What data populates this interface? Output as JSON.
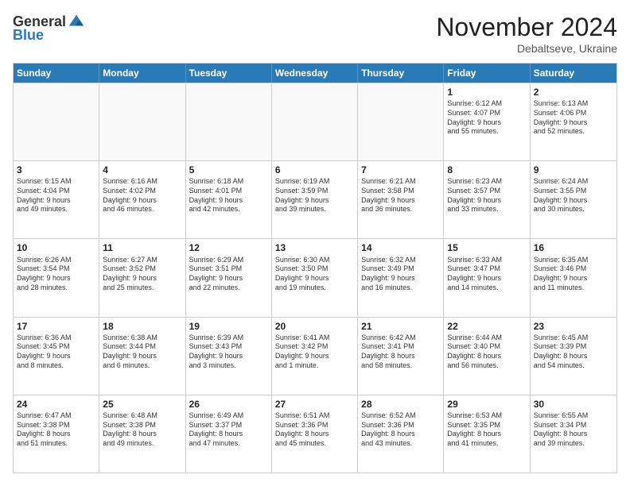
{
  "logo": {
    "general": "General",
    "blue": "Blue"
  },
  "title": "November 2024",
  "location": "Debaltseve, Ukraine",
  "header_days": [
    "Sunday",
    "Monday",
    "Tuesday",
    "Wednesday",
    "Thursday",
    "Friday",
    "Saturday"
  ],
  "rows": [
    [
      {
        "day": "",
        "text": "",
        "empty": true
      },
      {
        "day": "",
        "text": "",
        "empty": true
      },
      {
        "day": "",
        "text": "",
        "empty": true
      },
      {
        "day": "",
        "text": "",
        "empty": true
      },
      {
        "day": "",
        "text": "",
        "empty": true
      },
      {
        "day": "1",
        "text": "Sunrise: 6:12 AM\nSunset: 4:07 PM\nDaylight: 9 hours\nand 55 minutes.",
        "empty": false
      },
      {
        "day": "2",
        "text": "Sunrise: 6:13 AM\nSunset: 4:06 PM\nDaylight: 9 hours\nand 52 minutes.",
        "empty": false
      }
    ],
    [
      {
        "day": "3",
        "text": "Sunrise: 6:15 AM\nSunset: 4:04 PM\nDaylight: 9 hours\nand 49 minutes.",
        "empty": false
      },
      {
        "day": "4",
        "text": "Sunrise: 6:16 AM\nSunset: 4:02 PM\nDaylight: 9 hours\nand 46 minutes.",
        "empty": false
      },
      {
        "day": "5",
        "text": "Sunrise: 6:18 AM\nSunset: 4:01 PM\nDaylight: 9 hours\nand 42 minutes.",
        "empty": false
      },
      {
        "day": "6",
        "text": "Sunrise: 6:19 AM\nSunset: 3:59 PM\nDaylight: 9 hours\nand 39 minutes.",
        "empty": false
      },
      {
        "day": "7",
        "text": "Sunrise: 6:21 AM\nSunset: 3:58 PM\nDaylight: 9 hours\nand 36 minutes.",
        "empty": false
      },
      {
        "day": "8",
        "text": "Sunrise: 6:23 AM\nSunset: 3:57 PM\nDaylight: 9 hours\nand 33 minutes.",
        "empty": false
      },
      {
        "day": "9",
        "text": "Sunrise: 6:24 AM\nSunset: 3:55 PM\nDaylight: 9 hours\nand 30 minutes.",
        "empty": false
      }
    ],
    [
      {
        "day": "10",
        "text": "Sunrise: 6:26 AM\nSunset: 3:54 PM\nDaylight: 9 hours\nand 28 minutes.",
        "empty": false
      },
      {
        "day": "11",
        "text": "Sunrise: 6:27 AM\nSunset: 3:52 PM\nDaylight: 9 hours\nand 25 minutes.",
        "empty": false
      },
      {
        "day": "12",
        "text": "Sunrise: 6:29 AM\nSunset: 3:51 PM\nDaylight: 9 hours\nand 22 minutes.",
        "empty": false
      },
      {
        "day": "13",
        "text": "Sunrise: 6:30 AM\nSunset: 3:50 PM\nDaylight: 9 hours\nand 19 minutes.",
        "empty": false
      },
      {
        "day": "14",
        "text": "Sunrise: 6:32 AM\nSunset: 3:49 PM\nDaylight: 9 hours\nand 16 minutes.",
        "empty": false
      },
      {
        "day": "15",
        "text": "Sunrise: 6:33 AM\nSunset: 3:47 PM\nDaylight: 9 hours\nand 14 minutes.",
        "empty": false
      },
      {
        "day": "16",
        "text": "Sunrise: 6:35 AM\nSunset: 3:46 PM\nDaylight: 9 hours\nand 11 minutes.",
        "empty": false
      }
    ],
    [
      {
        "day": "17",
        "text": "Sunrise: 6:36 AM\nSunset: 3:45 PM\nDaylight: 9 hours\nand 8 minutes.",
        "empty": false
      },
      {
        "day": "18",
        "text": "Sunrise: 6:38 AM\nSunset: 3:44 PM\nDaylight: 9 hours\nand 6 minutes.",
        "empty": false
      },
      {
        "day": "19",
        "text": "Sunrise: 6:39 AM\nSunset: 3:43 PM\nDaylight: 9 hours\nand 3 minutes.",
        "empty": false
      },
      {
        "day": "20",
        "text": "Sunrise: 6:41 AM\nSunset: 3:42 PM\nDaylight: 9 hours\nand 1 minute.",
        "empty": false
      },
      {
        "day": "21",
        "text": "Sunrise: 6:42 AM\nSunset: 3:41 PM\nDaylight: 8 hours\nand 58 minutes.",
        "empty": false
      },
      {
        "day": "22",
        "text": "Sunrise: 6:44 AM\nSunset: 3:40 PM\nDaylight: 8 hours\nand 56 minutes.",
        "empty": false
      },
      {
        "day": "23",
        "text": "Sunrise: 6:45 AM\nSunset: 3:39 PM\nDaylight: 8 hours\nand 54 minutes.",
        "empty": false
      }
    ],
    [
      {
        "day": "24",
        "text": "Sunrise: 6:47 AM\nSunset: 3:38 PM\nDaylight: 8 hours\nand 51 minutes.",
        "empty": false
      },
      {
        "day": "25",
        "text": "Sunrise: 6:48 AM\nSunset: 3:38 PM\nDaylight: 8 hours\nand 49 minutes.",
        "empty": false
      },
      {
        "day": "26",
        "text": "Sunrise: 6:49 AM\nSunset: 3:37 PM\nDaylight: 8 hours\nand 47 minutes.",
        "empty": false
      },
      {
        "day": "27",
        "text": "Sunrise: 6:51 AM\nSunset: 3:36 PM\nDaylight: 8 hours\nand 45 minutes.",
        "empty": false
      },
      {
        "day": "28",
        "text": "Sunrise: 6:52 AM\nSunset: 3:36 PM\nDaylight: 8 hours\nand 43 minutes.",
        "empty": false
      },
      {
        "day": "29",
        "text": "Sunrise: 6:53 AM\nSunset: 3:35 PM\nDaylight: 8 hours\nand 41 minutes.",
        "empty": false
      },
      {
        "day": "30",
        "text": "Sunrise: 6:55 AM\nSunset: 3:34 PM\nDaylight: 8 hours\nand 39 minutes.",
        "empty": false
      }
    ]
  ]
}
